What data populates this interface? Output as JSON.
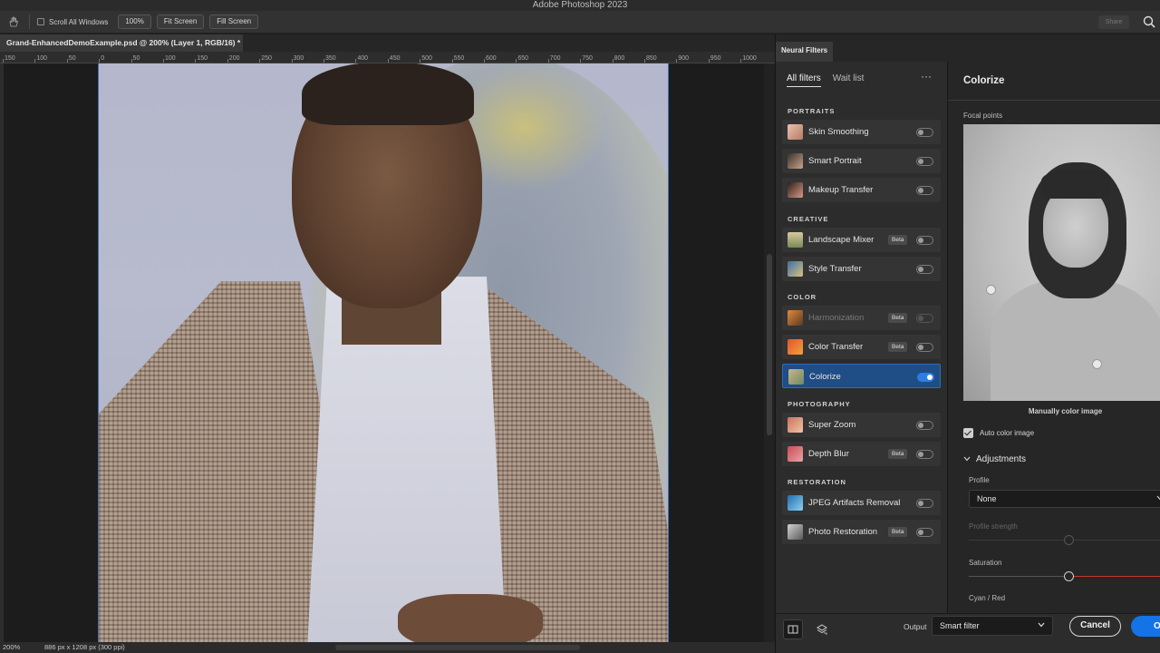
{
  "app": {
    "title": "Adobe Photoshop 2023"
  },
  "options_bar": {
    "scroll_all_windows": "Scroll All Windows",
    "zoom_100": "100%",
    "fit_screen": "Fit Screen",
    "fill_screen": "Fill Screen",
    "share": "Share"
  },
  "document": {
    "tab_title": "Grand-EnhancedDemoExample.psd @ 200% (Layer 1, RGB/16) *",
    "zoom": "200%",
    "dimensions": "886 px x 1208 px (300 ppi)"
  },
  "ruler": {
    "labels": [
      "150",
      "100",
      "50",
      "0",
      "50",
      "100",
      "150",
      "200",
      "250",
      "300",
      "350",
      "400",
      "450",
      "500",
      "550",
      "600",
      "650",
      "700",
      "750",
      "800",
      "850",
      "900",
      "950",
      "1000"
    ]
  },
  "neural_filters": {
    "panel_title": "Neural Filters",
    "tabs": {
      "all": "All filters",
      "wait": "Wait list"
    },
    "more": "···",
    "categories": {
      "portraits": "PORTRAITS",
      "creative": "CREATIVE",
      "color": "COLOR",
      "photography": "PHOTOGRAPHY",
      "restoration": "RESTORATION"
    },
    "beta_label": "Beta",
    "filters": {
      "skin_smoothing": "Skin Smoothing",
      "smart_portrait": "Smart Portrait",
      "makeup_transfer": "Makeup Transfer",
      "landscape_mixer": "Landscape Mixer",
      "style_transfer": "Style Transfer",
      "harmonization": "Harmonization",
      "color_transfer": "Color Transfer",
      "colorize": "Colorize",
      "super_zoom": "Super Zoom",
      "depth_blur": "Depth Blur",
      "jpeg_artifacts": "JPEG Artifacts Removal",
      "photo_restoration": "Photo Restoration"
    }
  },
  "colorize": {
    "title": "Colorize",
    "focal_points": "Focal points",
    "manually": "Manually color image",
    "auto_color": "Auto color image",
    "adjustments": "Adjustments",
    "profile_label": "Profile",
    "profile_value": "None",
    "profile_strength": "Profile strength",
    "saturation": "Saturation",
    "cyan_red": "Cyan / Red"
  },
  "footer": {
    "output_label": "Output",
    "output_value": "Smart filter",
    "cancel": "Cancel",
    "ok": "OK"
  },
  "colors": {
    "accent": "#1473e6",
    "selected_row": "#1f4d85"
  }
}
